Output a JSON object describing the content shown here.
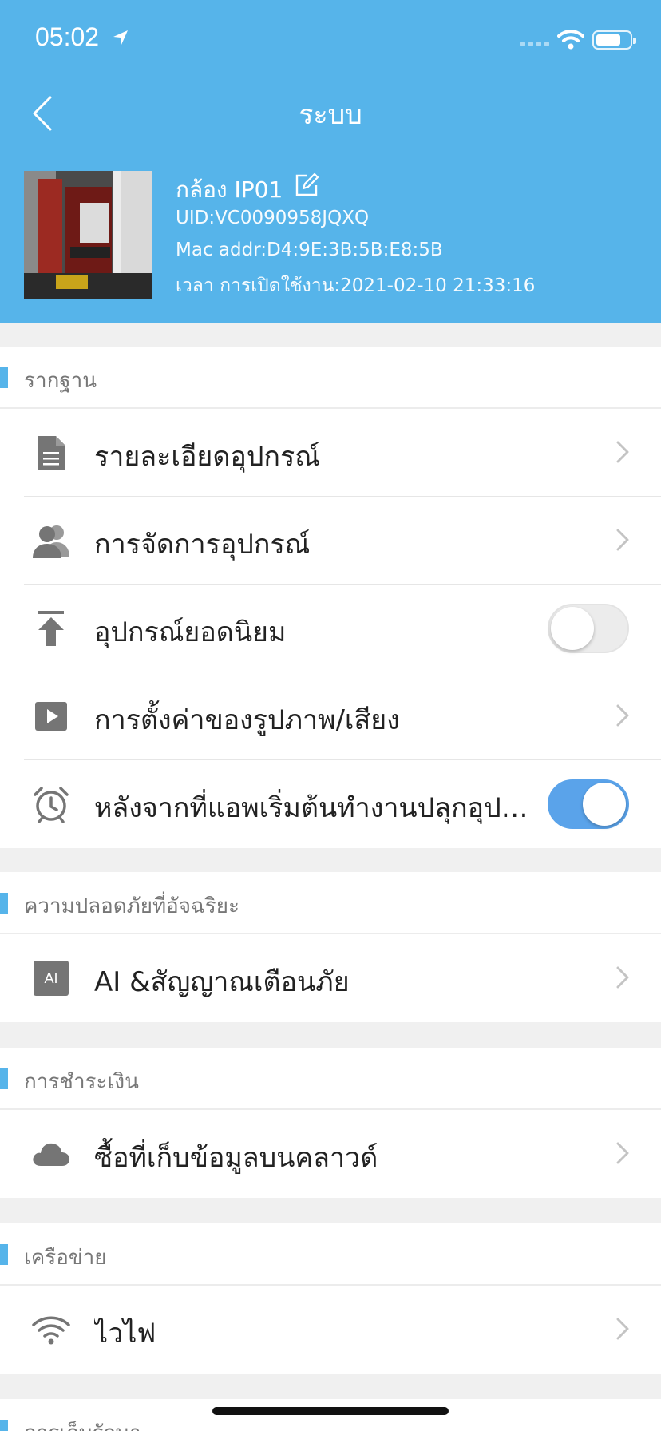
{
  "status_bar": {
    "time": "05:02"
  },
  "header": {
    "title": "ระบบ"
  },
  "device": {
    "name": "กล้อง IP01",
    "uid": "UID:VC0090958JQXQ",
    "mac": "Mac addr:D4:9E:3B:5B:E8:5B",
    "activation": "เวลา การเปิดใช้งาน:2021-02-10 21:33:16"
  },
  "sections": {
    "basic": {
      "title": "รากฐาน",
      "items": [
        {
          "label": "รายละเอียดอุปกรณ์",
          "icon": "document-icon"
        },
        {
          "label": "การจัดการอุปกรณ์",
          "icon": "users-icon"
        },
        {
          "label": "อุปกรณ์ยอดนิยม",
          "icon": "pin-top-icon",
          "toggle": false
        },
        {
          "label": "การตั้งค่าของรูปภาพ/เสียง",
          "icon": "play-icon"
        },
        {
          "label": "หลังจากที่แอพเริ่มต้นทำงานปลุกอุปก...",
          "icon": "alarm-clock-icon",
          "toggle": true
        }
      ]
    },
    "security": {
      "title": "ความปลอดภัยที่อัจฉริยะ",
      "items": [
        {
          "label": "AI &สัญญาณเตือนภัย",
          "icon": "ai-icon",
          "badge": "AI"
        }
      ]
    },
    "payment": {
      "title": "การชำระเงิน",
      "items": [
        {
          "label": "ซื้อที่เก็บข้อมูลบนคลาวด์",
          "icon": "cloud-icon"
        }
      ]
    },
    "network": {
      "title": "เครือข่าย",
      "items": [
        {
          "label": "ไวไฟ",
          "icon": "wifi-icon"
        }
      ]
    },
    "storage": {
      "title": "การเก็บรักษา"
    }
  },
  "colors": {
    "accent": "#56b4ea",
    "toggle_on": "#5aa3ea",
    "icon_gray": "#757575"
  }
}
